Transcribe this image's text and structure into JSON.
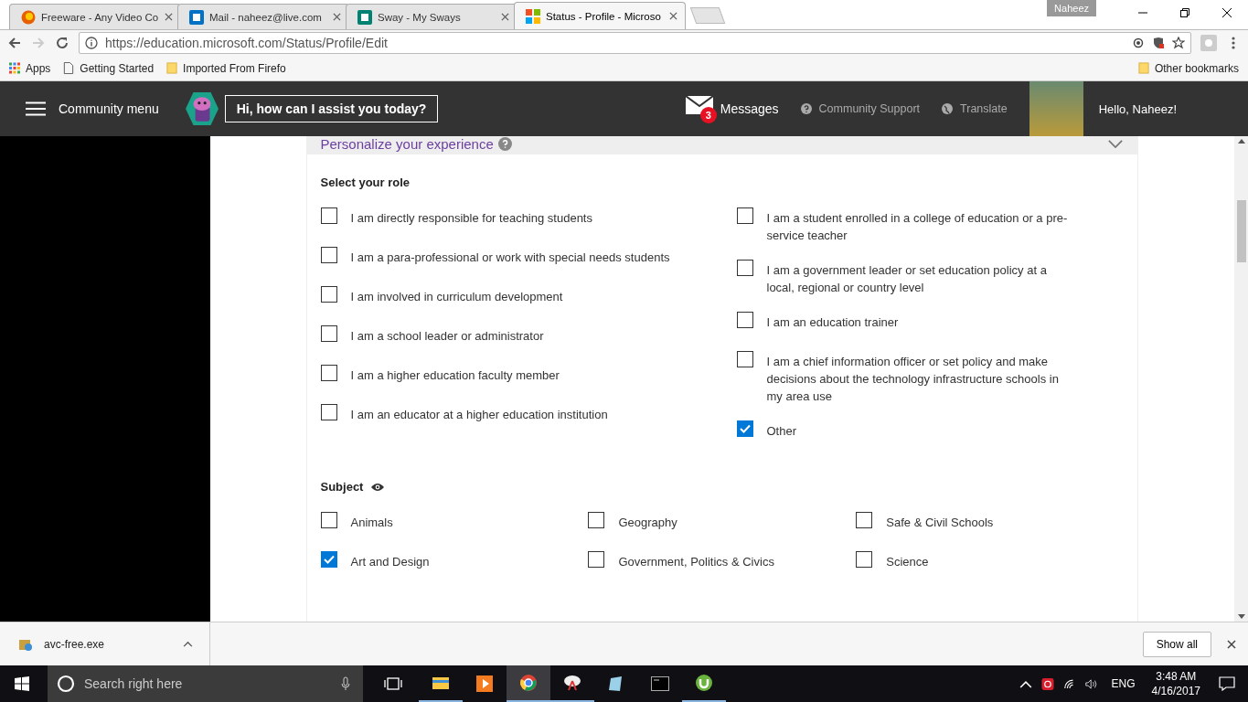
{
  "browser": {
    "tabs": [
      {
        "title": "Freeware - Any Video Co",
        "selected": false,
        "kind": "firefox"
      },
      {
        "title": "Mail - naheez@live.com",
        "selected": false,
        "kind": "outlook"
      },
      {
        "title": "Sway - My Sways",
        "selected": false,
        "kind": "sway"
      },
      {
        "title": "Status - Profile - Microso",
        "selected": true,
        "kind": "microsoft"
      }
    ],
    "profile_name": "Naheez",
    "address": "https://education.microsoft.com/Status/Profile/Edit",
    "bookmarks": [
      {
        "label": "Apps",
        "kind": "apps"
      },
      {
        "label": "Getting Started",
        "kind": "page"
      },
      {
        "label": "Imported From Firefo",
        "kind": "folder"
      }
    ],
    "other_bookmarks": "Other bookmarks"
  },
  "header": {
    "menu_label": "Community menu",
    "assistant_prompt": "Hi, how can I assist you today?",
    "messages": {
      "label": "Messages",
      "count": "3"
    },
    "links": [
      {
        "label": "Community Support",
        "kind": "help"
      },
      {
        "label": "Translate",
        "kind": "globe"
      }
    ],
    "greeting": "Hello, Naheez!"
  },
  "section": {
    "title": "Personalize your experience",
    "expanded": true
  },
  "role": {
    "title": "Select your role",
    "columns": [
      [
        {
          "label": "I am directly responsible for teaching students",
          "checked": false
        },
        {
          "label": "I am a para-professional or work with special needs students",
          "checked": false
        },
        {
          "label": "I am involved in curriculum development",
          "checked": false
        },
        {
          "label": "I am a school leader or administrator",
          "checked": false
        },
        {
          "label": "I am a higher education faculty member",
          "checked": false
        },
        {
          "label": "I am an educator at a higher education institution",
          "checked": false
        }
      ],
      [
        {
          "label": "I am a student enrolled in a college of education or a pre-service teacher",
          "checked": false
        },
        {
          "label": "I am a government leader or set education policy at a local, regional or country level",
          "checked": false
        },
        {
          "label": "I am an education trainer",
          "checked": false
        },
        {
          "label": "I am a chief information officer or set policy and make decisions about the technology infrastructure schools in my area use",
          "checked": false
        },
        {
          "label": "Other",
          "checked": true
        }
      ]
    ]
  },
  "subject": {
    "title": "Subject",
    "columns": [
      [
        {
          "label": "Animals",
          "checked": false
        },
        {
          "label": "Art and Design",
          "checked": true
        }
      ],
      [
        {
          "label": "Geography",
          "checked": false
        },
        {
          "label": "Government, Politics & Civics",
          "checked": false
        }
      ],
      [
        {
          "label": "Safe & Civil Schools",
          "checked": false
        },
        {
          "label": "Science",
          "checked": false
        }
      ]
    ]
  },
  "download_bar": {
    "file": "avc-free.exe",
    "show_all": "Show all"
  },
  "taskbar": {
    "search_placeholder": "Search right here",
    "language": "ENG",
    "time": "3:48 AM",
    "date": "4/16/2017"
  }
}
